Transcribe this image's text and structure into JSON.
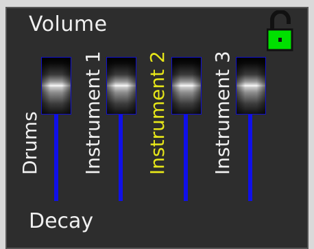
{
  "panel": {
    "title": "Volume",
    "footer_label": "Decay",
    "lock_state": "unlocked"
  },
  "colors": {
    "panel_bg": "#2d2d2d",
    "label_default": "#f0f0f0",
    "label_selected": "#e6e619",
    "track": "#1010e8",
    "lock_body": "#00e000"
  },
  "channels": [
    {
      "label": "Drums",
      "selected": false,
      "level": 0.72
    },
    {
      "label": "Instrument 1",
      "selected": false,
      "level": 0.72
    },
    {
      "label": "Instrument 2",
      "selected": true,
      "level": 0.72
    },
    {
      "label": "Instrument 3",
      "selected": false,
      "level": 0.72
    }
  ],
  "icons": {
    "lock": "padlock-open-icon"
  }
}
